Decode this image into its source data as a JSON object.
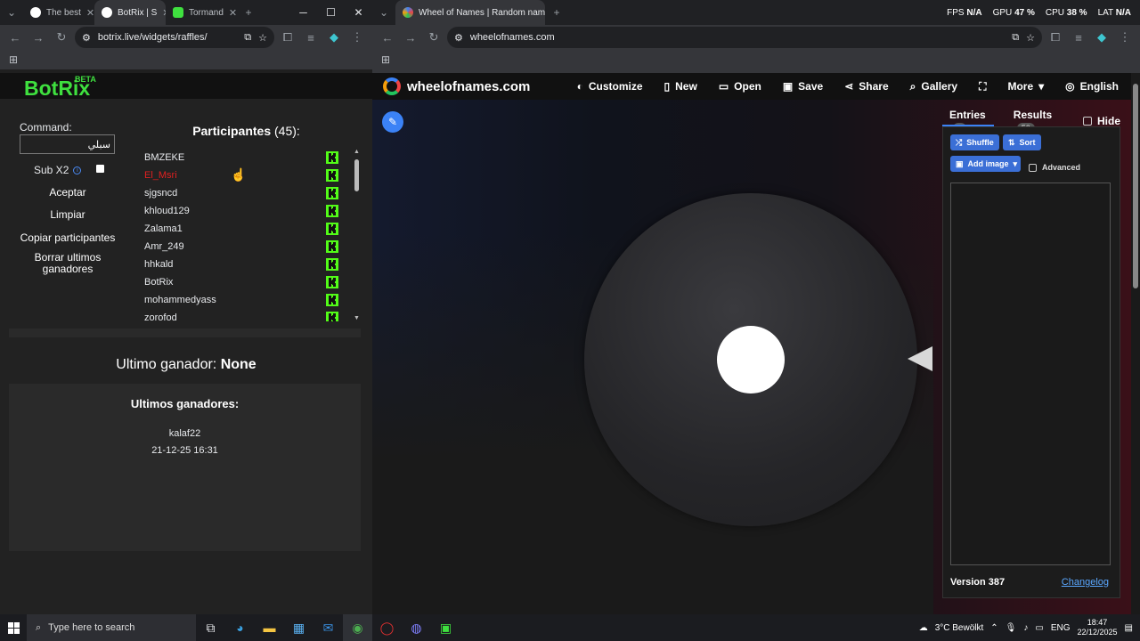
{
  "left_window": {
    "tabs": [
      {
        "label": "The best",
        "favicon_color": "#ffffff"
      },
      {
        "label": "BotRix | S",
        "favicon_color": "#ffffff"
      },
      {
        "label": "Tormand",
        "favicon_color": "#3fe03f"
      }
    ],
    "url": "botrix.live/widgets/raffles/"
  },
  "botrix": {
    "logo": "BotRix",
    "beta": "BETA",
    "command_label": "Command:",
    "command_value": "سبلي",
    "subx2_label": "Sub X2",
    "buttons": {
      "accept": "Aceptar",
      "clear": "Limpiar",
      "copy": "Copiar participantes",
      "delete_line1": "Borrar ultimos",
      "delete_line2": "ganadores"
    },
    "participants_title": "Participantes",
    "participants_count": "(45):",
    "participants": [
      {
        "name": "BMZEKE",
        "highlight": false
      },
      {
        "name": "El_Msri",
        "highlight": true
      },
      {
        "name": "sjgsncd",
        "highlight": false
      },
      {
        "name": "khloud129",
        "highlight": false
      },
      {
        "name": "Zalama1",
        "highlight": false
      },
      {
        "name": "Amr_249",
        "highlight": false
      },
      {
        "name": "hhkald",
        "highlight": false
      },
      {
        "name": "BotRix",
        "highlight": false
      },
      {
        "name": "mohammedyass",
        "highlight": false
      },
      {
        "name": "zorofod",
        "highlight": false
      }
    ],
    "last_winner_label": "Ultimo ganador:",
    "last_winner_value": "None",
    "winners_title": "Ultimos ganadores:",
    "winners": [
      {
        "name": "kalaf22",
        "date": "21-12-25 16:31"
      }
    ],
    "accent_color": "#3fe03f"
  },
  "right_window": {
    "tab_label": "Wheel of Names | Random nam",
    "url": "wheelofnames.com",
    "stats": {
      "fps_label": "FPS",
      "fps_value": "N/A",
      "gpu_label": "GPU",
      "gpu_value": "47 %",
      "cpu_label": "CPU",
      "cpu_value": "38 %",
      "lat_label": "LAT",
      "lat_value": "N/A"
    }
  },
  "wheel": {
    "site_name": "wheelofnames.com",
    "menu": [
      {
        "icon": "palette-icon",
        "label": "Customize"
      },
      {
        "icon": "file-icon",
        "label": "New"
      },
      {
        "icon": "folder-icon",
        "label": "Open"
      },
      {
        "icon": "save-icon",
        "label": "Save"
      },
      {
        "icon": "share-icon",
        "label": "Share"
      },
      {
        "icon": "search-icon",
        "label": "Gallery"
      },
      {
        "icon": "fullscreen-icon",
        "label": ""
      },
      {
        "icon": "chevron-down-icon",
        "label": "More"
      },
      {
        "icon": "globe-icon",
        "label": "English"
      }
    ],
    "entries_tab": "Entries",
    "entries_count": "0",
    "results_tab": "Results",
    "results_count": "50",
    "hide_label": "Hide",
    "shuffle": "Shuffle",
    "sort": "Sort",
    "add_image": "Add image",
    "advanced": "Advanced",
    "version": "Version 387",
    "changelog": "Changelog",
    "accent_color": "#3b82f6"
  },
  "taskbar": {
    "search_placeholder": "Type here to search",
    "weather": "3°C Bewölkt",
    "lang": "ENG",
    "time": "18:47",
    "date": "22/12/2025"
  }
}
